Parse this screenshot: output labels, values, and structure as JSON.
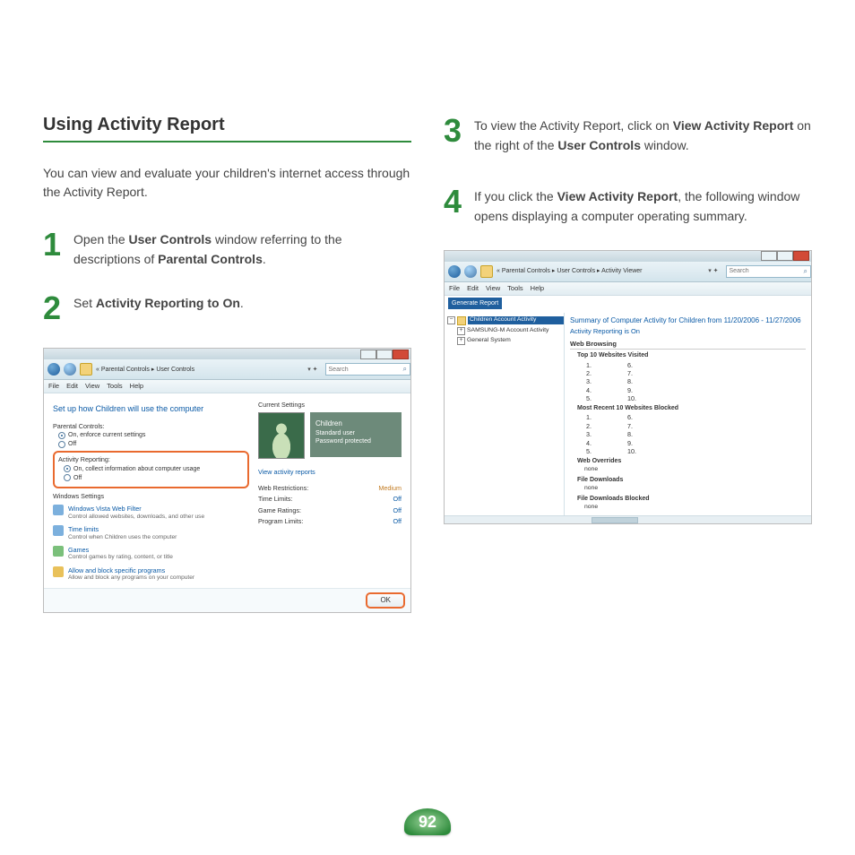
{
  "pageNumber": "92",
  "left": {
    "heading": "Using Activity Report",
    "intro": "You can view and evaluate your children's internet access through the Activity Report.",
    "step1": {
      "num": "1",
      "pre": "Open the ",
      "b1": "User Controls",
      "mid": " window referring to the descriptions of ",
      "b2": "Parental Controls",
      "post": "."
    },
    "step2": {
      "num": "2",
      "pre": "Set ",
      "b1": "Activity Reporting to On",
      "post": "."
    }
  },
  "right": {
    "step3": {
      "num": "3",
      "pre": "To view the Activity Report, click on ",
      "b1": "View Activity Report",
      "mid": " on the right of the ",
      "b2": "User Controls",
      "post": " window."
    },
    "step4": {
      "num": "4",
      "pre": "If you click the ",
      "b1": "View Activity Report",
      "post": ", the following window opens displaying a computer operating summary."
    }
  },
  "ss1": {
    "breadcrumb": "« Parental Controls  ▸  User Controls",
    "searchPlaceholder": "Search",
    "menu": [
      "File",
      "Edit",
      "View",
      "Tools",
      "Help"
    ],
    "setupHeading": "Set up how Children will use the computer",
    "pcLabel": "Parental Controls:",
    "pcOn": "On, enforce current settings",
    "pcOff": "Off",
    "arLabel": "Activity Reporting:",
    "arOn": "On, collect information about computer usage",
    "arOff": "Off",
    "wsLabel": "Windows Settings",
    "ws1t": "Windows Vista Web Filter",
    "ws1d": "Control allowed websites, downloads, and other use",
    "ws2t": "Time limits",
    "ws2d": "Control when Children uses the computer",
    "ws3t": "Games",
    "ws3d": "Control games by rating, content, or title",
    "ws4t": "Allow and block specific programs",
    "ws4d": "Allow and block any programs on your computer",
    "csLabel": "Current Settings",
    "childName": "Children",
    "childLine1": "Standard user",
    "childLine2": "Password protected",
    "viewReports": "View activity reports",
    "settings": {
      "webRestrict": {
        "k": "Web Restrictions:",
        "v": "Medium"
      },
      "timeLimits": {
        "k": "Time Limits:",
        "v": "Off"
      },
      "gameRatings": {
        "k": "Game Ratings:",
        "v": "Off"
      },
      "programLimits": {
        "k": "Program Limits:",
        "v": "Off"
      }
    },
    "ok": "OK"
  },
  "ss2": {
    "breadcrumb": "« Parental Controls  ▸  User Controls  ▸  Activity Viewer",
    "searchPlaceholder": "Search",
    "menu": [
      "File",
      "Edit",
      "View",
      "Tools",
      "Help"
    ],
    "generate": "Generate Report",
    "tree": {
      "n1": "Children Account Activity",
      "n2": "SAMSUNG-M Account Activity",
      "n3": "General System"
    },
    "summaryTitle": "Summary of Computer Activity for Children from 11/20/2006 - 11/27/2006",
    "reportingOn": "Activity Reporting is On",
    "webBrowsing": "Web Browsing",
    "top10": "Top 10 Websites Visited",
    "recent10": "Most Recent 10 Websites Blocked",
    "colA": [
      "1.",
      "2.",
      "3.",
      "4.",
      "5."
    ],
    "colB": [
      "6.",
      "7.",
      "8.",
      "9.",
      "10."
    ],
    "webOverrides": "Web Overrides",
    "fileDownloads": "File Downloads",
    "fileDownloadsBlocked": "File Downloads Blocked",
    "none": "none"
  }
}
